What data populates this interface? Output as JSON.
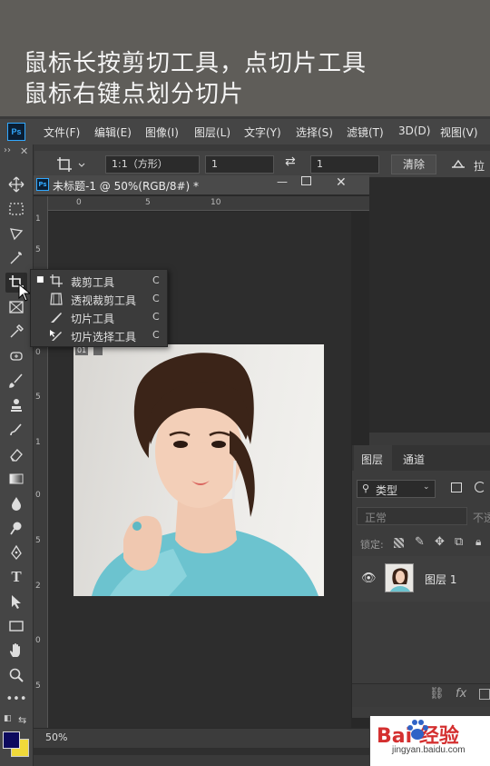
{
  "caption": {
    "line1": "鼠标长按剪切工具，点切片工具",
    "line2": "鼠标右键点划分切片"
  },
  "app": {
    "logo": "Ps",
    "menu": [
      "文件(F)",
      "编辑(E)",
      "图像(I)",
      "图层(L)",
      "文字(Y)",
      "选择(S)",
      "滤镜(T)",
      "3D(D)",
      "视图(V)"
    ]
  },
  "options_bar": {
    "ratio": "1:1（方形）",
    "width_value": "1",
    "height_value": "1",
    "clear_label": "清除",
    "straighten_label": "拉"
  },
  "document": {
    "tab_title": "未标题-1 @ 50%(RGB/8#) *",
    "zoom": "50%",
    "ruler_top": [
      "0",
      "5",
      "10"
    ],
    "ruler_left": [
      "1",
      "5",
      "2",
      "0",
      "5",
      "1",
      "0",
      "5",
      "2",
      "0",
      "5"
    ],
    "slice_badge": "01"
  },
  "crop_flyout": {
    "items": [
      {
        "label": "裁剪工具",
        "key": "C",
        "icon": "crop-icon"
      },
      {
        "label": "透视裁剪工具",
        "key": "C",
        "icon": "perspective-crop-icon"
      },
      {
        "label": "切片工具",
        "key": "C",
        "icon": "slice-icon"
      },
      {
        "label": "切片选择工具",
        "key": "C",
        "icon": "slice-select-icon"
      }
    ]
  },
  "layers_panel": {
    "tabs": [
      "图层",
      "通道"
    ],
    "filter_kind": "类型",
    "blend_mode": "正常",
    "opacity_label": "不透",
    "lock_label": "锁定:",
    "layer_name": "图层 1"
  },
  "watermark": {
    "brand": "Bai 经验",
    "url": "jingyan.baidu.com"
  },
  "colors": {
    "foreground": "#0d0a5e",
    "background": "#f0d93a",
    "accent": "#31a8ff"
  }
}
